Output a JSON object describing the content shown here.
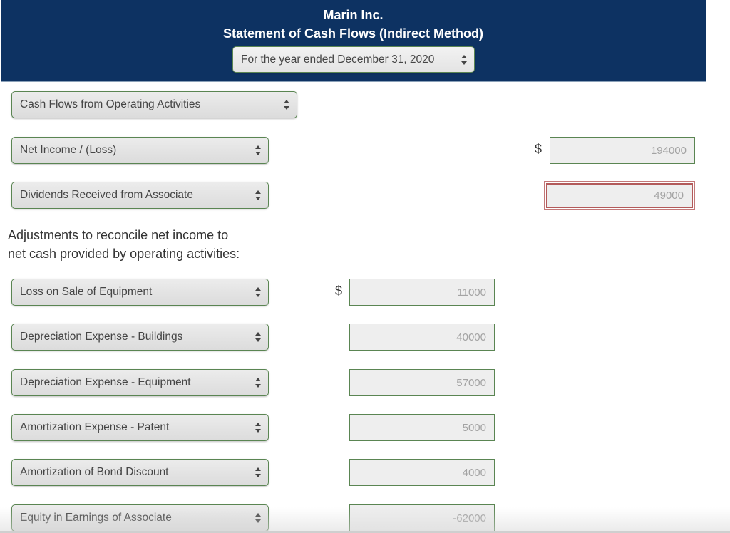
{
  "header": {
    "company": "Marin Inc.",
    "statement": "Statement of Cash Flows (Indirect Method)",
    "period_select": "For the year ended December 31, 2020"
  },
  "section_select": "Cash Flows from Operating Activities",
  "top_rows": [
    {
      "label": "Net Income / (Loss)",
      "currency": "$",
      "amount": "194000",
      "error": false
    },
    {
      "label": "Dividends Received from Associate",
      "currency": "",
      "amount": "49000",
      "error": true
    }
  ],
  "adjustments_label_line1": "Adjustments to reconcile net income to",
  "adjustments_label_line2": "net cash provided by operating activities:",
  "adjustments": [
    {
      "label": "Loss on Sale of Equipment",
      "currency": "$",
      "amount": "11000"
    },
    {
      "label": "Depreciation Expense - Buildings",
      "currency": "",
      "amount": "40000"
    },
    {
      "label": "Depreciation Expense - Equipment",
      "currency": "",
      "amount": "57000"
    },
    {
      "label": "Amortization Expense - Patent",
      "currency": "",
      "amount": "5000"
    },
    {
      "label": "Amortization of Bond Discount",
      "currency": "",
      "amount": "4000"
    },
    {
      "label": "Equity in Earnings of Associate",
      "currency": "",
      "amount": "-62000"
    }
  ],
  "colors": {
    "header_bg": "#0d3262",
    "field_border": "#5a8552",
    "error_border": "#b35a5a"
  }
}
